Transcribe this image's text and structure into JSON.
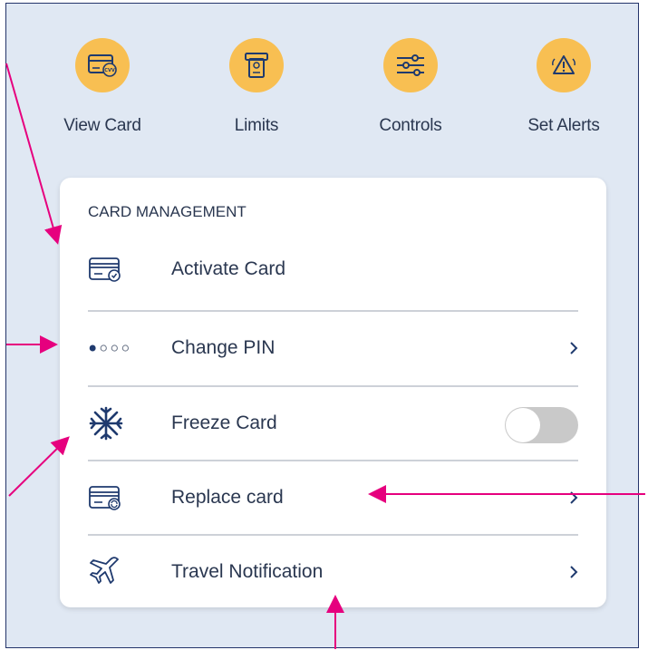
{
  "quick_actions": [
    {
      "label": "View Card",
      "icon": "cvv-card-icon"
    },
    {
      "label": "Limits",
      "icon": "atm-icon"
    },
    {
      "label": "Controls",
      "icon": "sliders-icon"
    },
    {
      "label": "Set Alerts",
      "icon": "alert-triangle-icon"
    }
  ],
  "card_management": {
    "heading": "CARD MANAGEMENT",
    "items": [
      {
        "label": "Activate Card",
        "icon": "card-check-icon"
      },
      {
        "label": "Change PIN",
        "icon": "pin-dots-icon",
        "has_chevron": true
      },
      {
        "label": "Freeze Card",
        "icon": "snowflake-icon",
        "toggle": false
      },
      {
        "label": "Replace card",
        "icon": "card-refresh-icon",
        "has_chevron": true
      },
      {
        "label": "Travel Notification",
        "icon": "airplane-icon",
        "has_chevron": true
      }
    ]
  },
  "colors": {
    "background": "#e0e8f3",
    "accent": "#f8bf52",
    "text": "#2a3750",
    "icon": "#1f3a6e",
    "annotation": "#e6007e"
  }
}
